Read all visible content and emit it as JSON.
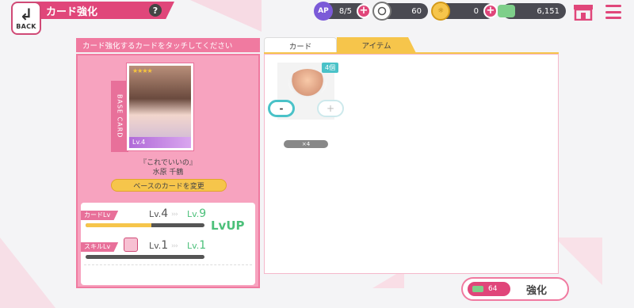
{
  "header": {
    "back_label": "BACK",
    "title": "カード強化",
    "help": "?",
    "resources": [
      {
        "name": "ap",
        "icon": "ap-icon",
        "icon_text": "AP",
        "value": "8/5"
      },
      {
        "name": "gem",
        "icon": "gem-icon",
        "value": "60"
      },
      {
        "name": "coin",
        "icon": "coin-icon",
        "value": "0"
      },
      {
        "name": "money",
        "icon": "money-icon",
        "value": "6,151"
      }
    ]
  },
  "left_panel": {
    "instruction": "カード強化するカードをタッチしてください",
    "base_card_tab": "BASE CARD",
    "card": {
      "level": "Lv.4",
      "title": "『これでいいの』",
      "character": "水原 千鶴",
      "stars": "★★★★"
    },
    "change_button": "ベースのカードを変更",
    "card_lv": {
      "label": "カードLv",
      "current": "Lv.",
      "current_num": "4",
      "next": "Lv.",
      "next_num": "9",
      "arrows": "›››",
      "lvup": "LvUP",
      "progress": 0.55
    },
    "skill_lv": {
      "label": "スキルLv",
      "current": "Lv.",
      "current_num": "1",
      "next": "Lv.",
      "next_num": "1",
      "arrows": "›››",
      "progress": 0.0
    }
  },
  "right_panel": {
    "tabs": [
      "カード",
      "アイテム"
    ],
    "active_tab": "アイテム",
    "items": [
      {
        "count_badge": "4個",
        "quantity": "×4",
        "minus": "-",
        "plus": "+"
      }
    ]
  },
  "enhance": {
    "cost": "64",
    "label": "強化"
  },
  "colors": {
    "accent": "#e0467a",
    "panel_pink": "#f7a3bf",
    "yellow": "#f6c54b",
    "teal": "#4ac2c8",
    "green": "#4cc07a"
  }
}
